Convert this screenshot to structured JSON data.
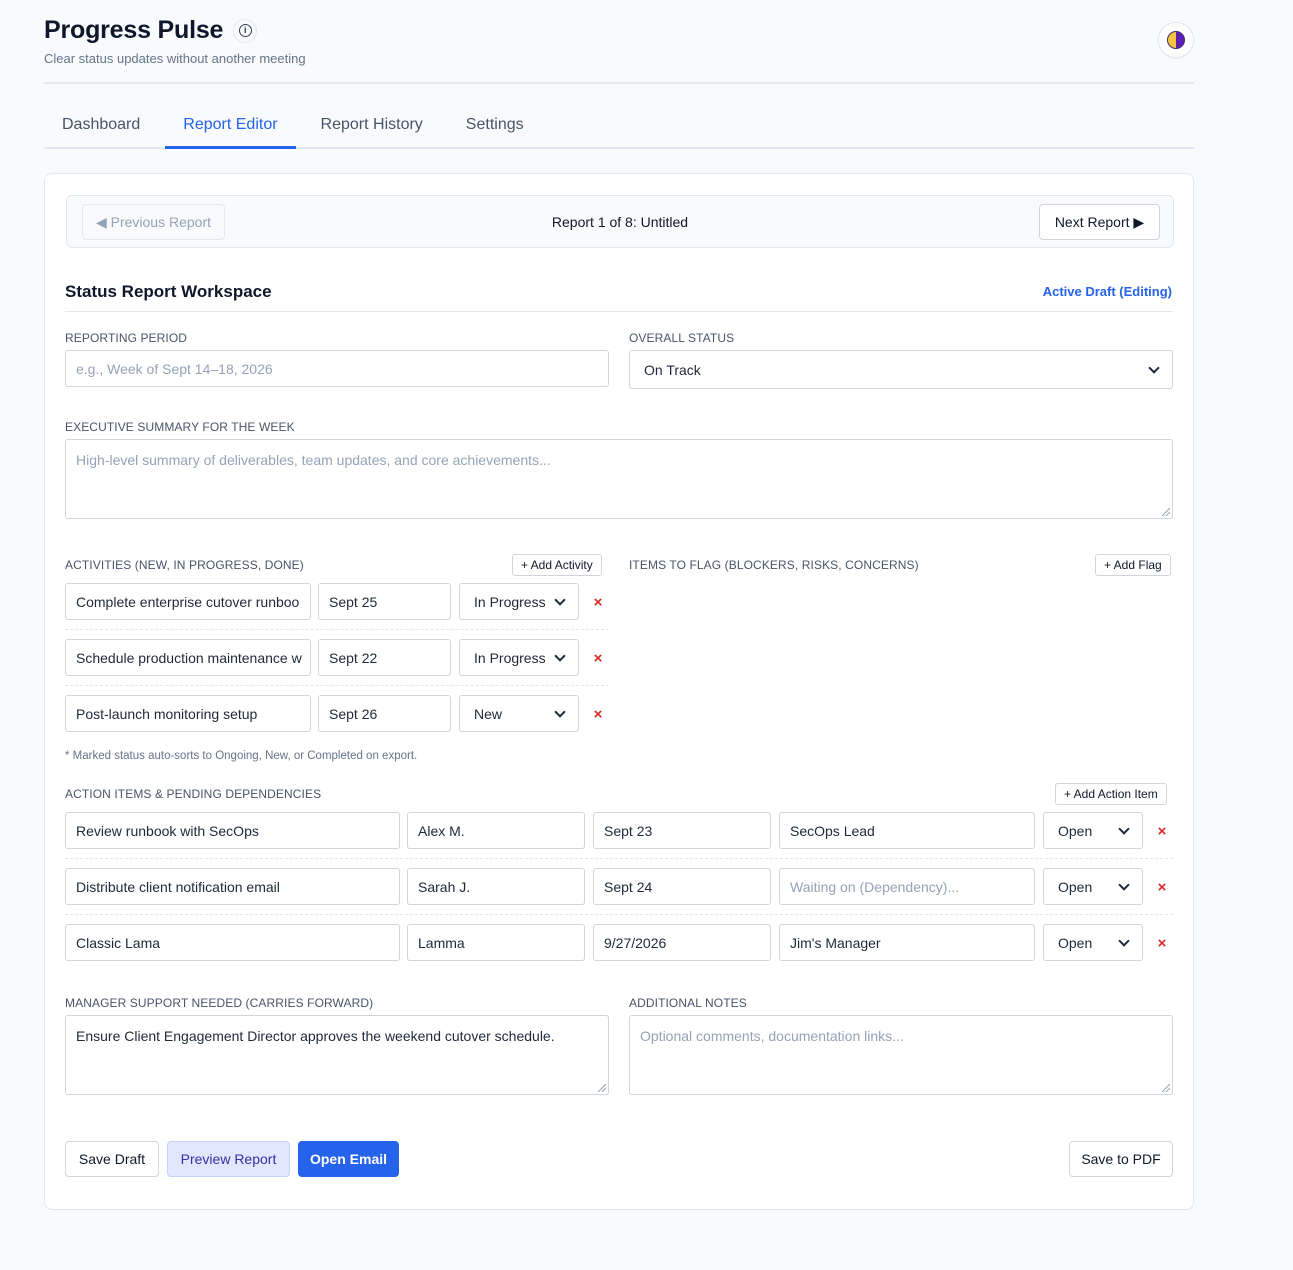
{
  "app": {
    "title": "Progress Pulse",
    "subtitle": "Clear status updates without another meeting",
    "info_icon": "info-icon",
    "theme_icon": "theme-toggle-icon"
  },
  "tabs": [
    {
      "label": "Dashboard",
      "active": false
    },
    {
      "label": "Report Editor",
      "active": true
    },
    {
      "label": "Report History",
      "active": false
    },
    {
      "label": "Settings",
      "active": false
    }
  ],
  "report_nav": {
    "previous_label": "◀ Previous Report",
    "title": "Report 1 of 8: Untitled",
    "next_label": "Next Report ▶"
  },
  "workspace": {
    "title": "Status Report Workspace",
    "badge": "Active Draft (Editing)",
    "accent_color": "#2563eb"
  },
  "reporting_period": {
    "label": "REPORTING PERIOD",
    "value": "",
    "placeholder": "e.g., Week of Sept 14–18, 2026"
  },
  "overall_status": {
    "label": "OVERALL STATUS",
    "value": "On Track"
  },
  "executive_summary": {
    "label": "EXECUTIVE SUMMARY FOR THE WEEK",
    "value": "",
    "placeholder": "High-level summary of deliverables, team updates, and core achievements..."
  },
  "activities": {
    "label": "ACTIVITIES (NEW, IN PROGRESS, DONE)",
    "add_label": "+ Add Activity",
    "items": [
      {
        "name": "Complete enterprise cutover runboo",
        "date": "Sept 25",
        "status": "In Progress"
      },
      {
        "name": "Schedule production maintenance w",
        "date": "Sept 22",
        "status": "In Progress"
      },
      {
        "name": "Post-launch monitoring setup",
        "date": "Sept 26",
        "status": "New"
      }
    ],
    "note": "* Marked status auto-sorts to Ongoing, New, or Completed on export."
  },
  "flags": {
    "label": "ITEMS TO FLAG (BLOCKERS, RISKS, CONCERNS)",
    "add_label": "+ Add Flag"
  },
  "action_items": {
    "label": "ACTION ITEMS & PENDING DEPENDENCIES",
    "add_label": "+ Add Action Item",
    "items": [
      {
        "task": "Review runbook with SecOps",
        "owner": "Alex M.",
        "due": "Sept 23",
        "dependency": "SecOps Lead",
        "dependency_placeholder": "Waiting on (Dependency)...",
        "status": "Open"
      },
      {
        "task": "Distribute client notification email",
        "owner": "Sarah J.",
        "due": "Sept 24",
        "dependency": "",
        "dependency_placeholder": "Waiting on (Dependency)...",
        "status": "Open"
      },
      {
        "task": "Classic Lama",
        "owner": "Lamma",
        "due": "9/27/2026",
        "dependency": "Jim's Manager",
        "dependency_placeholder": "Waiting on (Dependency)...",
        "status": "Open"
      }
    ]
  },
  "manager_support": {
    "label": "MANAGER SUPPORT NEEDED (CARRIES FORWARD)",
    "value": "Ensure Client Engagement Director approves the weekend cutover schedule."
  },
  "additional_notes": {
    "label": "ADDITIONAL NOTES",
    "value": "",
    "placeholder": "Optional comments, documentation links..."
  },
  "footer": {
    "save_draft": "Save Draft",
    "preview": "Preview Report",
    "open_email": "Open Email",
    "save_pdf": "Save to PDF"
  },
  "remove_glyph": "×"
}
